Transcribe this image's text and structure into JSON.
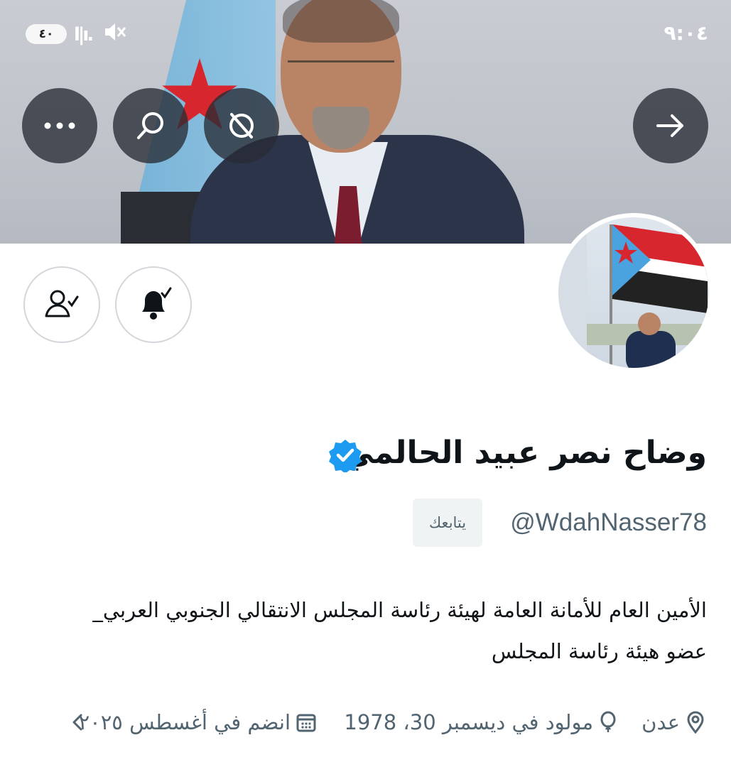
{
  "status_bar": {
    "time": "٩:٠٤",
    "battery": "٤٠"
  },
  "profile": {
    "display_name": "وضاح نصر عبيد الحالمي",
    "handle": "@WdahNasser78",
    "follows_you": "يتابعك",
    "bio_line1": "الأمين العام للأمانة العامة لهيئة رئاسة المجلس الانتقالي الجنوبي العربي_",
    "bio_line2": "عضو هيئة رئاسة المجلس",
    "location": "عدن",
    "birth": "مولود في ديسمبر 30، 1978",
    "joined": "انضم في أغسطس ٢٠٢٥",
    "verified": true
  },
  "icons": {
    "back": "arrow-right-icon",
    "grok": "slash-circle-icon",
    "search": "search-icon",
    "more": "more-icon",
    "notifications": "bell-check-icon",
    "following": "person-check-icon",
    "location": "location-pin-icon",
    "birth": "balloon-icon",
    "joined": "calendar-icon",
    "expand": "chevron-left-icon"
  },
  "colors": {
    "verified": "#1d9bf0",
    "muted_text": "#536471",
    "overlay": "#2c3038"
  }
}
